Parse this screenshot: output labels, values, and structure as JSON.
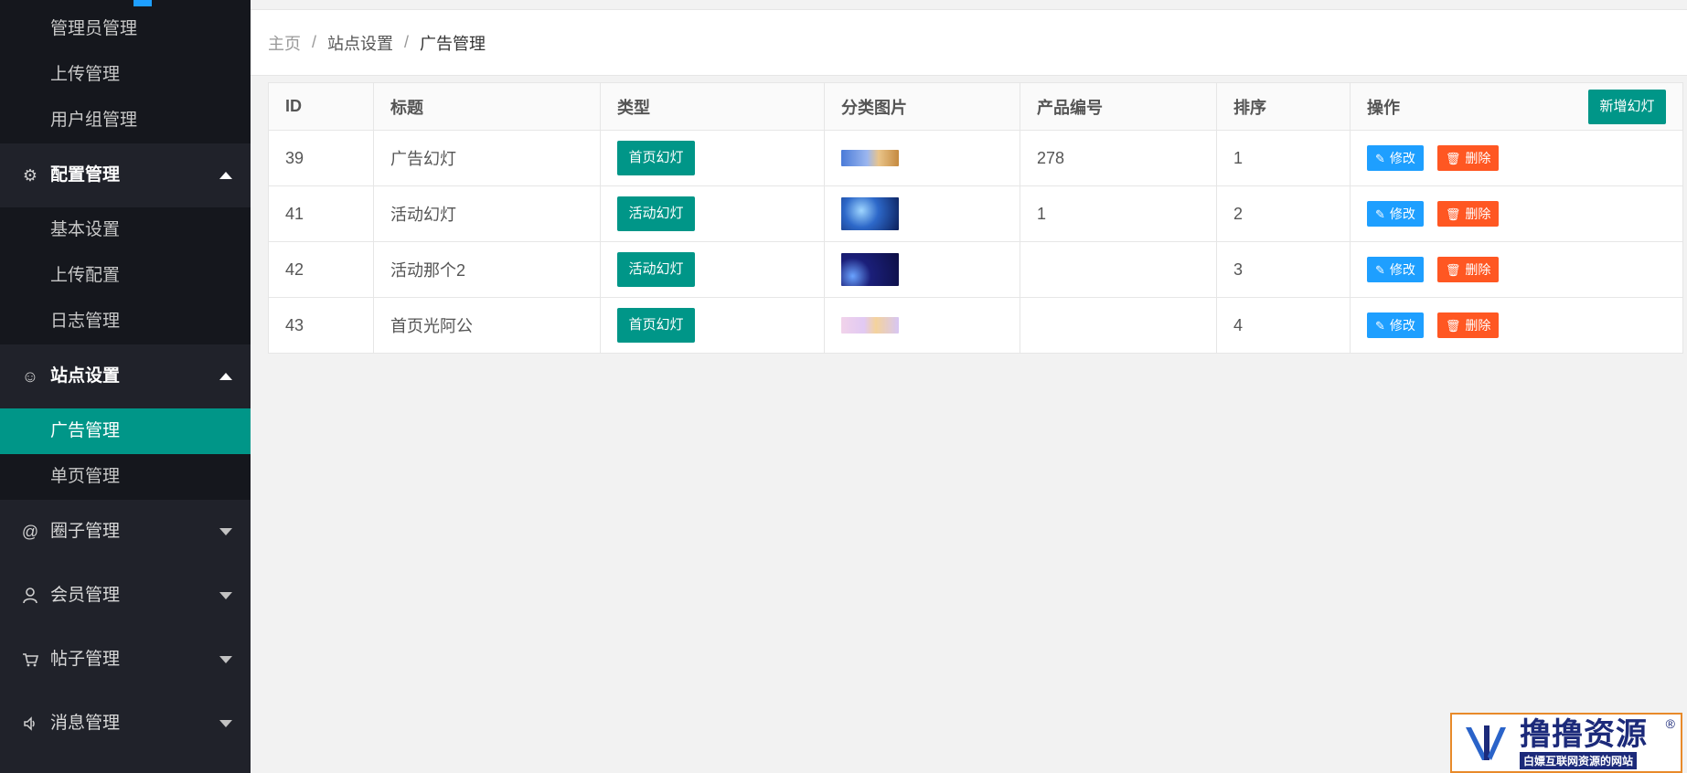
{
  "sidebar": {
    "group1": [
      "管理员管理",
      "上传管理",
      "用户组管理"
    ],
    "config": {
      "label": "配置管理",
      "icon": "gear-icon",
      "items": [
        "基本设置",
        "上传配置",
        "日志管理"
      ]
    },
    "site": {
      "label": "站点设置",
      "icon": "smile-icon",
      "items": [
        "广告管理",
        "单页管理"
      ],
      "active": "广告管理"
    },
    "menus": [
      {
        "label": "圈子管理",
        "icon": "at-icon"
      },
      {
        "label": "会员管理",
        "icon": "user-icon"
      },
      {
        "label": "帖子管理",
        "icon": "cart-icon"
      },
      {
        "label": "消息管理",
        "icon": "speaker-icon"
      }
    ]
  },
  "breadcrumb": {
    "home": "主页",
    "section": "站点设置",
    "current": "广告管理",
    "sep": "/"
  },
  "table": {
    "headers": {
      "id": "ID",
      "title": "标题",
      "type": "类型",
      "image": "分类图片",
      "product": "产品编号",
      "sort": "排序",
      "actions": "操作"
    },
    "add_button": "新增幻灯",
    "edit_label": "修改",
    "delete_label": "删除",
    "rows": [
      {
        "id": "39",
        "title": "广告幻灯",
        "type": "首页幻灯",
        "product": "278",
        "sort": "1"
      },
      {
        "id": "41",
        "title": "活动幻灯",
        "type": "活动幻灯",
        "product": "1",
        "sort": "2"
      },
      {
        "id": "42",
        "title": "活动那个2",
        "type": "活动幻灯",
        "product": "",
        "sort": "3"
      },
      {
        "id": "43",
        "title": "首页光阿公",
        "type": "首页幻灯",
        "product": "",
        "sort": "4"
      }
    ]
  },
  "watermark": {
    "title": "撸撸资源",
    "subtitle": "白嫖互联网资源的网站",
    "mark": "®"
  },
  "colors": {
    "sidebar_bg": "#20222a",
    "active": "#009688",
    "edit": "#1e9fff",
    "delete": "#ff5722"
  }
}
